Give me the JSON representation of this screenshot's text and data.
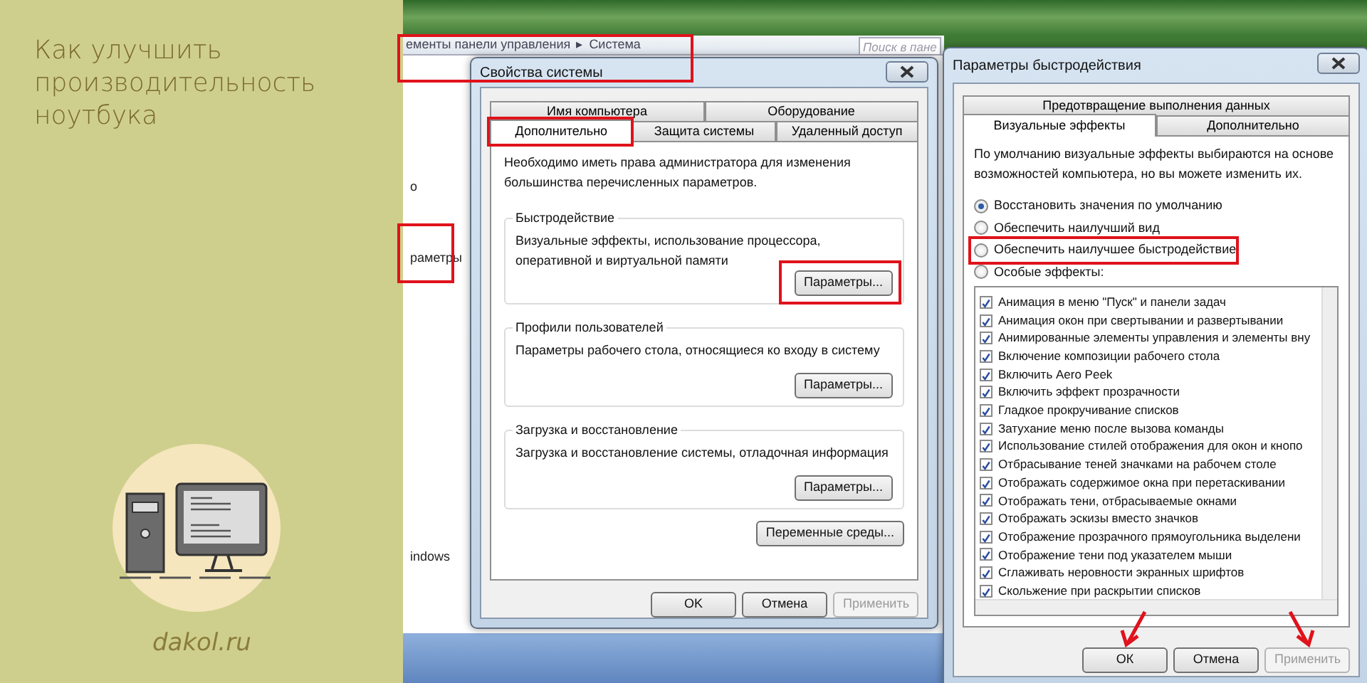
{
  "article": {
    "title": "Как улучшить производительность ноутбука",
    "site": "dakol.ru"
  },
  "background_window": {
    "breadcrumb": [
      "ементы панели управления",
      "Система"
    ],
    "separator": "▸",
    "highlighted": true,
    "search": {
      "placeholder": "Поиск в пане"
    },
    "side_texts": [
      {
        "text": "о",
        "highlighted": false
      },
      {
        "text": "раметры",
        "highlighted": true
      },
      {
        "text": "indows",
        "highlighted": false
      }
    ]
  },
  "system_properties": {
    "title": "Свойства системы",
    "tab_rows": [
      [
        {
          "label": "Имя компьютера",
          "selected": false,
          "highlighted": false
        },
        {
          "label": "Оборудование",
          "selected": false,
          "highlighted": false
        }
      ],
      [
        {
          "label": "Дополнительно",
          "selected": true,
          "highlighted": true
        },
        {
          "label": "Защита системы",
          "selected": false,
          "highlighted": false
        },
        {
          "label": "Удаленный доступ",
          "selected": false,
          "highlighted": false
        }
      ]
    ],
    "note": "Необходимо иметь права администратора для изменения большинства перечисленных параметров.",
    "groups": [
      {
        "legend": "Быстродействие",
        "text": "Визуальные эффекты, использование процессора, оперативной и виртуальной памяти",
        "button": {
          "label": "Параметры...",
          "highlighted": true
        }
      },
      {
        "legend": "Профили пользователей",
        "text": "Параметры рабочего стола, относящиеся ко входу в систему",
        "button": {
          "label": "Параметры...",
          "highlighted": false
        }
      },
      {
        "legend": "Загрузка и восстановление",
        "text": "Загрузка и восстановление системы, отладочная информация",
        "button": {
          "label": "Параметры...",
          "highlighted": false
        }
      }
    ],
    "extra_button": "Переменные среды...",
    "buttons": [
      {
        "label": "OK",
        "disabled": false,
        "arrow": false
      },
      {
        "label": "Отмена",
        "disabled": false,
        "arrow": false
      },
      {
        "label": "Применить",
        "disabled": true,
        "arrow": false
      }
    ]
  },
  "performance_options": {
    "title": "Параметры быстродействия",
    "tab_rows": [
      [
        {
          "label": "Предотвращение выполнения данных",
          "selected": false,
          "highlighted": false
        }
      ],
      [
        {
          "label": "Визуальные эффекты",
          "selected": true,
          "highlighted": false
        },
        {
          "label": "Дополнительно",
          "selected": false,
          "highlighted": false
        }
      ]
    ],
    "description": "По умолчанию визуальные эффекты выбираются на основе возможностей компьютера, но вы можете изменить их.",
    "options": [
      {
        "label": "Восстановить значения по умолчанию",
        "selected": true,
        "highlighted": false
      },
      {
        "label": "Обеспечить наилучший вид",
        "selected": false,
        "highlighted": false
      },
      {
        "label": "Обеспечить наилучшее быстродействие",
        "selected": false,
        "highlighted": true
      },
      {
        "label": "Особые эффекты:",
        "selected": false,
        "highlighted": false
      }
    ],
    "effects": [
      {
        "label": "Анимация в меню \"Пуск\" и панели задач",
        "checked": true
      },
      {
        "label": "Анимация окон при свертывании и развертывании",
        "checked": true
      },
      {
        "label": "Анимированные элементы управления и элементы вну",
        "checked": true
      },
      {
        "label": "Включение композиции рабочего стола",
        "checked": true
      },
      {
        "label": "Включить Aero Peek",
        "checked": true
      },
      {
        "label": "Включить эффект прозрачности",
        "checked": true
      },
      {
        "label": "Гладкое прокручивание списков",
        "checked": true
      },
      {
        "label": "Затухание меню после вызова команды",
        "checked": true
      },
      {
        "label": "Использование стилей отображения для окон и кнопо",
        "checked": true
      },
      {
        "label": "Отбрасывание теней значками на рабочем столе",
        "checked": true
      },
      {
        "label": "Отображать содержимое окна при перетаскивании",
        "checked": true
      },
      {
        "label": "Отображать тени, отбрасываемые окнами",
        "checked": true
      },
      {
        "label": "Отображать эскизы вместо значков",
        "checked": true
      },
      {
        "label": "Отображение прозрачного прямоугольника выделени",
        "checked": true
      },
      {
        "label": "Отображение тени под указателем мыши",
        "checked": true
      },
      {
        "label": "Сглаживать неровности экранных шрифтов",
        "checked": true
      },
      {
        "label": "Скольжение при раскрытии списков",
        "checked": true
      }
    ],
    "buttons": [
      {
        "label": "ОК",
        "disabled": false,
        "arrow": true
      },
      {
        "label": "Отмена",
        "disabled": false,
        "arrow": false
      },
      {
        "label": "Применить",
        "disabled": true,
        "arrow": true
      }
    ]
  }
}
